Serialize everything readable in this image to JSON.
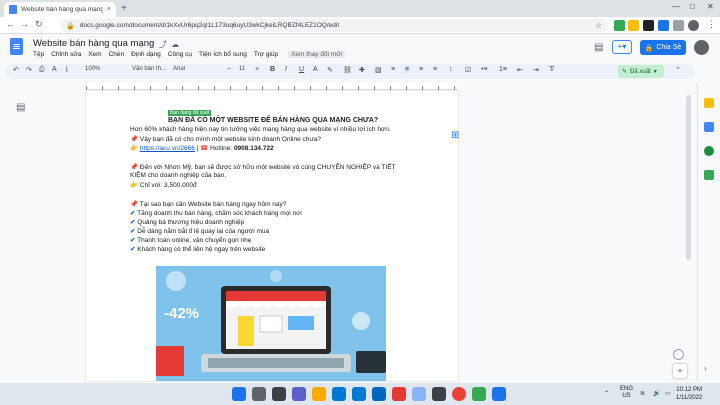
{
  "browser": {
    "tab_title": "Website bán hàng qua mạng - G",
    "tab_close": "×",
    "new_tab": "+",
    "url": "docs.google.com/document/d/1kXvUr6pq2qI1L173uq6uyU3wkCjkeiLRQBZf4LEZ1OQ/edit"
  },
  "docs": {
    "title": "Website bán hàng qua mạng",
    "menus": [
      "Tệp",
      "Chỉnh sửa",
      "Xem",
      "Chèn",
      "Định dạng",
      "Công cụ",
      "Tiện ích bổ sung",
      "Trợ giúp"
    ],
    "last_edit": "Xem thay đổi mới",
    "share_label": "Chia Sẻ"
  },
  "toolbar": {
    "zoom": "100%",
    "style": "Văn bản th...",
    "font": "Arial",
    "font_size": "11",
    "editing_mode": "Đã xuất"
  },
  "document": {
    "status_tag": "Bạn đang đã xuất",
    "heading": "BẠN ĐÃ CÓ MỘT WEBSITE ĐỂ BÁN HÀNG QUA MẠNG CHƯA?",
    "line1": "Hơn 60% khách hàng hiện nay tin tưởng việc mang hàng qua website vì nhiều lợi ích hơn.",
    "line2": "Vậy bạn đã có cho mình một website kinh doanh Online chưa?",
    "link": "https://acu.vn/2666",
    "hotline_label": "Hotline:",
    "hotline": "0908.134.722",
    "line4a": "Đến với Nhơn Mỹ, bạn sẽ được sở hữu một website vô cùng CHUYÊN NGHIỆP và TIẾT",
    "line4b": "KIỆM cho doanh nghiệp của bạn.",
    "price": "Chỉ với: 3,500,000đ",
    "question": "Tại sao bạn cần Website bán hàng ngay hôm nay?",
    "benefits": [
      "Tăng doanh thu bán hàng, chăm sóc khách hàng mọi nơi",
      "Quảng bá thương hiệu doanh nghiệp",
      "Dễ dàng nắm bắt tỉ lệ quay lại của người mua",
      "Thanh toán online, vận chuyển gọn nhẹ",
      "Khách hàng có thể liên hệ ngay trên website"
    ],
    "discount": "-42%"
  },
  "taskbar": {
    "lang": "ENG",
    "region": "US",
    "time": "10:12 PM",
    "date": "1/11/2022"
  },
  "colors": {
    "accent": "#1a73e8",
    "editing_bg": "#c4eed0",
    "status_tag_bg": "#34a853"
  }
}
